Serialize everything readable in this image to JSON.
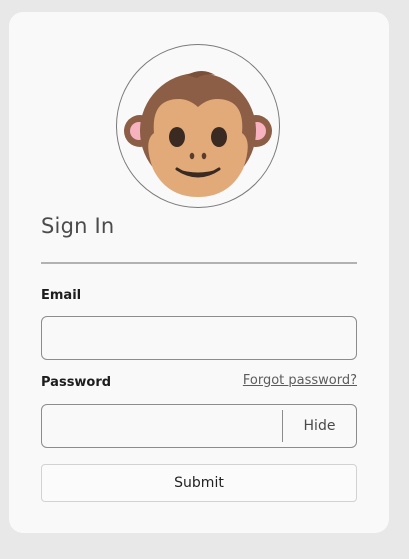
{
  "login": {
    "avatar_icon": "monkey-face-icon",
    "title": "Sign In",
    "email": {
      "label": "Email",
      "value": "",
      "placeholder": ""
    },
    "password": {
      "label": "Password",
      "value": "",
      "placeholder": "",
      "toggle_label": "Hide"
    },
    "forgot_link": "Forgot password?",
    "submit_label": "Submit"
  },
  "colors": {
    "background": "#e8e8e8",
    "card": "#f9f9f9",
    "monkey_fur": "#8b5e45",
    "monkey_face": "#e1aa78",
    "monkey_ear_inner": "#f7b2c0"
  }
}
